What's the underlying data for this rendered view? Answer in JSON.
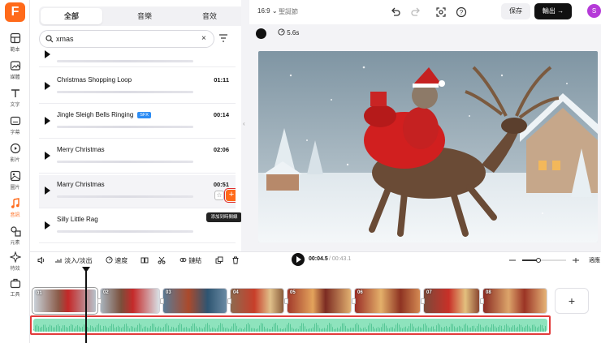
{
  "app": {
    "logo_letter": "F"
  },
  "rail": [
    {
      "name": "rail-template",
      "label": "範本"
    },
    {
      "name": "rail-media",
      "label": "媒體"
    },
    {
      "name": "rail-text",
      "label": "文字"
    },
    {
      "name": "rail-subtitles",
      "label": "字幕"
    },
    {
      "name": "rail-video",
      "label": "影片"
    },
    {
      "name": "rail-image",
      "label": "圖片"
    },
    {
      "name": "rail-audio",
      "label": "音訊"
    },
    {
      "name": "rail-elements",
      "label": "元素"
    },
    {
      "name": "rail-effects",
      "label": "特效"
    },
    {
      "name": "rail-tools",
      "label": "工具"
    }
  ],
  "panel": {
    "tabs": [
      "全部",
      "音樂",
      "音效"
    ],
    "search": {
      "value": "xmas",
      "clear": "×"
    },
    "items": [
      {
        "title": "",
        "duration": ""
      },
      {
        "title": "Christmas Shopping Loop",
        "duration": "01:11"
      },
      {
        "title": "Jingle Sleigh Bells Ringing",
        "duration": "00:14",
        "badge": "SFX"
      },
      {
        "title": "Merry Christmas",
        "duration": "02:06"
      },
      {
        "title": "Marry Christmas",
        "duration": "00:51"
      },
      {
        "title": "Silly Little Rag",
        "duration": ""
      }
    ],
    "add_symbol": "+",
    "tooltip": "添加到時間線"
  },
  "topbar": {
    "ratio": "16:9",
    "project_name": "聖誕節",
    "save": "保存",
    "export": "輸出 →",
    "avatar_letter": "S"
  },
  "subbar": {
    "duration": "5.6s"
  },
  "timeline": {
    "tools": {
      "fade": "淡入/淡出",
      "speed": "速度",
      "link": "鏈結"
    },
    "current_time": "00:04.5",
    "total_time": "/ 00:43.1",
    "fit": "適應",
    "clip_numbers": [
      "01",
      "02",
      "03",
      "04",
      "05",
      "06",
      "07",
      "08"
    ],
    "add_clip": "+"
  },
  "colors": {
    "accent": "#ff6a1a",
    "audio_track": "#8ee3bd",
    "highlight_border": "#e23b3b",
    "avatar": "#b53ad8"
  }
}
